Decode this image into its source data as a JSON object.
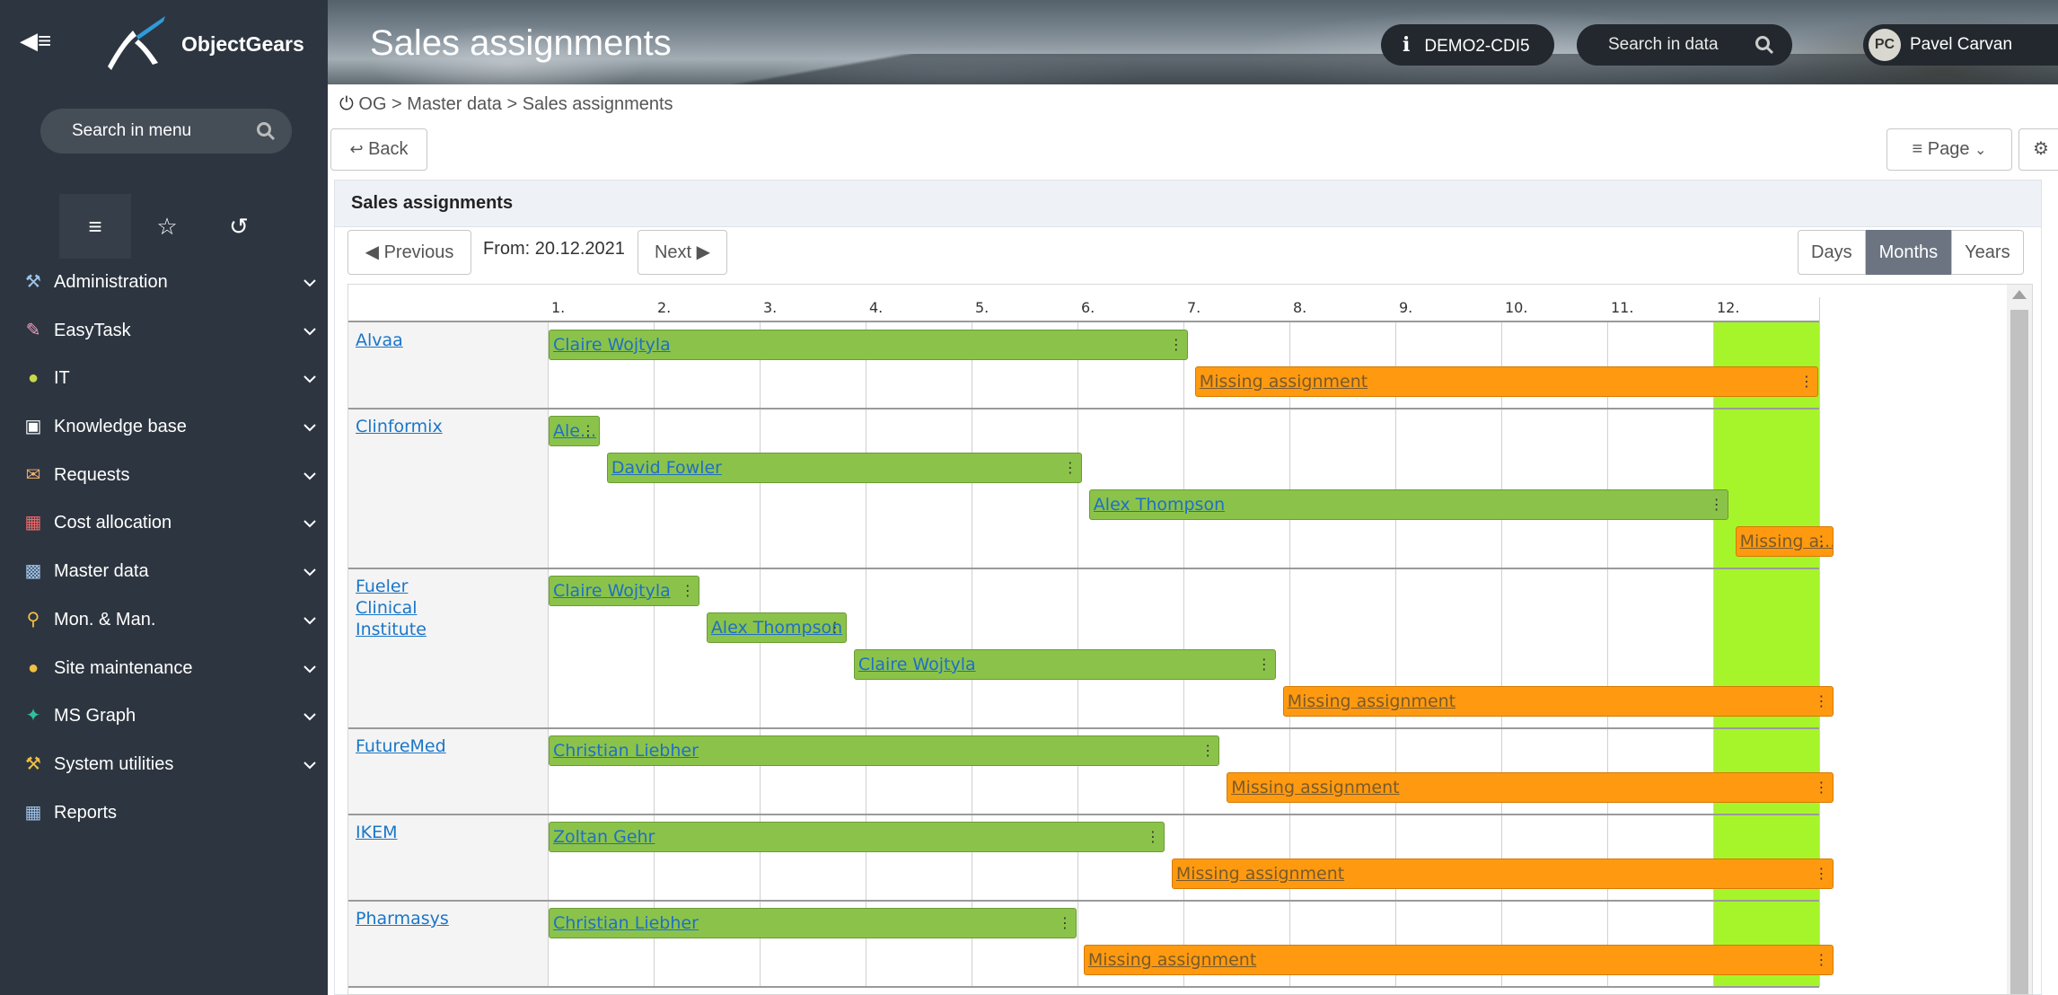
{
  "header": {
    "brand": "ObjectGears",
    "page_title": "Sales assignments",
    "environment": "DEMO2-CDI5",
    "search_placeholder": "Search in data",
    "user_initials": "PC",
    "user_name": "Pavel Carvan",
    "env_icon": "i"
  },
  "sidebar": {
    "search_placeholder": "Search in menu",
    "tabs": [
      "menu",
      "favorites",
      "history"
    ],
    "items": [
      {
        "label": "Administration",
        "icon": "tools-icon",
        "color": "#9fc3e8"
      },
      {
        "label": "EasyTask",
        "icon": "pencil-icon",
        "color": "#f0a0c0"
      },
      {
        "label": "IT",
        "icon": "it-icon",
        "color": "#c8d84a"
      },
      {
        "label": "Knowledge base",
        "icon": "book-icon",
        "color": "#ffffff"
      },
      {
        "label": "Requests",
        "icon": "request-icon",
        "color": "#f0b070"
      },
      {
        "label": "Cost allocation",
        "icon": "cost-icon",
        "color": "#f06a6a"
      },
      {
        "label": "Master data",
        "icon": "master-data-icon",
        "color": "#9fc3e8"
      },
      {
        "label": "Mon. & Man.",
        "icon": "monitor-icon",
        "color": "#f0c040"
      },
      {
        "label": "Site maintenance",
        "icon": "site-icon",
        "color": "#f0c040"
      },
      {
        "label": "MS Graph",
        "icon": "graph-icon",
        "color": "#2fc0a0"
      },
      {
        "label": "System utilities",
        "icon": "wrench-icon",
        "color": "#f0c040"
      },
      {
        "label": "Reports",
        "icon": "report-icon",
        "color": "#9fc3e8"
      }
    ]
  },
  "breadcrumb": "OG > Master data > Sales assignments",
  "toolbar": {
    "back_label": "Back",
    "page_label": "Page"
  },
  "panel": {
    "title": "Sales assignments",
    "prev_label": "Previous",
    "from_label": "From: 20.12.2021",
    "next_label": "Next",
    "views": [
      "Days",
      "Months",
      "Years"
    ],
    "active_view": "Months"
  },
  "timeline": {
    "months": [
      "1.",
      "2.",
      "3.",
      "4.",
      "5.",
      "6.",
      "7.",
      "8.",
      "9.",
      "10.",
      "11.",
      "12."
    ],
    "current_month_index": 11,
    "colors": {
      "assigned": "#8bc34a",
      "missing": "#ff9a10",
      "current": "#a6f52a"
    },
    "customers": [
      {
        "name": "Alvaa",
        "bars": [
          {
            "label": "Claire Wojtyla",
            "kind": "assigned",
            "start": 0,
            "end": 6.05
          },
          {
            "label": "Missing assignment",
            "kind": "missing",
            "start": 6.1,
            "end": 12
          }
        ]
      },
      {
        "name": "Clinformix",
        "bars": [
          {
            "label": "Ale...",
            "kind": "assigned",
            "start": 0,
            "end": 0.5
          },
          {
            "label": "David Fowler",
            "kind": "assigned",
            "start": 0.55,
            "end": 5.05
          },
          {
            "label": "Alex Thompson",
            "kind": "assigned",
            "start": 5.1,
            "end": 11.15
          },
          {
            "label": "Missing a...",
            "kind": "missing",
            "start": 11.2,
            "end": 12.14
          }
        ]
      },
      {
        "name": "Fueler Clinical Institute",
        "bars": [
          {
            "label": "Claire Wojtyla",
            "kind": "assigned",
            "start": 0,
            "end": 1.44
          },
          {
            "label": "Alex Thompson",
            "kind": "assigned",
            "start": 1.49,
            "end": 2.83
          },
          {
            "label": "Claire Wojtyla",
            "kind": "assigned",
            "start": 2.88,
            "end": 6.88
          },
          {
            "label": "Missing assignment",
            "kind": "missing",
            "start": 6.93,
            "end": 12.14
          }
        ]
      },
      {
        "name": "FutureMed",
        "bars": [
          {
            "label": "Christian Liebher",
            "kind": "assigned",
            "start": 0,
            "end": 6.35
          },
          {
            "label": "Missing assignment",
            "kind": "missing",
            "start": 6.4,
            "end": 12.14
          }
        ]
      },
      {
        "name": "IKEM",
        "bars": [
          {
            "label": "Zoltan Gehr",
            "kind": "assigned",
            "start": 0,
            "end": 5.83
          },
          {
            "label": "Missing assignment",
            "kind": "missing",
            "start": 5.88,
            "end": 12.14
          }
        ]
      },
      {
        "name": "Pharmasys",
        "bars": [
          {
            "label": "Christian Liebher",
            "kind": "assigned",
            "start": 0,
            "end": 5.0
          },
          {
            "label": "Missing assignment",
            "kind": "missing",
            "start": 5.05,
            "end": 12.14
          }
        ]
      }
    ]
  }
}
